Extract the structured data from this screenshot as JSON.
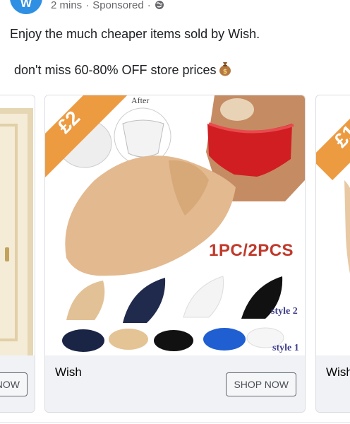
{
  "post": {
    "time": "2 mins",
    "sponsored": "Sponsored",
    "text_line1": "Enjoy the much cheaper items sold by Wish.",
    "text_line2": "don't miss 60-80% OFF store prices"
  },
  "cards": [
    {
      "brand": "",
      "button": "NOW"
    },
    {
      "brand": "Wish",
      "button": "SHOP NOW",
      "price_badge": "£2",
      "after_label": "After",
      "pack_label": "1PC/2PCS",
      "style2": "style 2",
      "style1": "style 1"
    },
    {
      "brand": "Wish",
      "price_badge": "£1"
    }
  ],
  "colors": {
    "accent_orange": "#ed9b41",
    "facebook_blue": "#2f8fe3",
    "pack_red": "#c0392b"
  }
}
